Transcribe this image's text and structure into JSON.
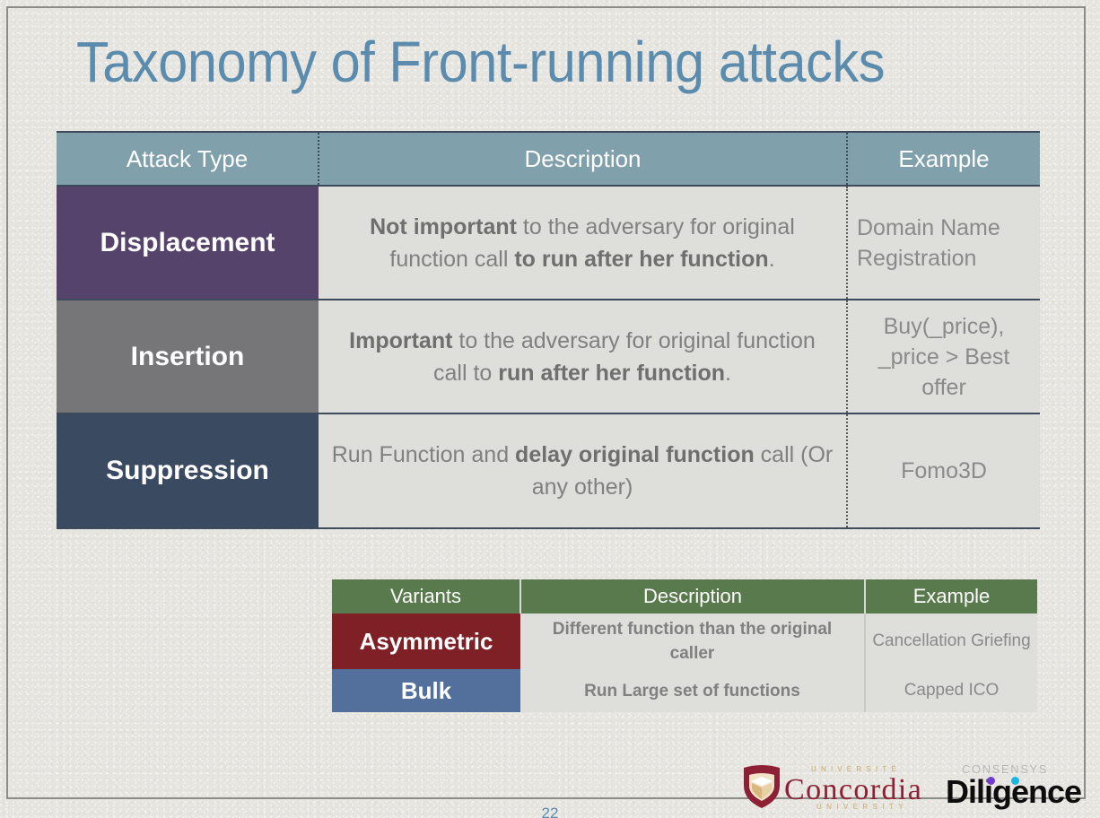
{
  "slide": {
    "title": "Taxonomy of Front-running attacks",
    "page_number": "22",
    "background_color": "#e6e5e0",
    "title_color": "#5b8cad",
    "frame_color": "#8d8d88"
  },
  "main_table": {
    "headers": [
      "Attack Type",
      "Description",
      "Example"
    ],
    "header_bg": "#80a0ac",
    "rows": [
      {
        "type": "Displacement",
        "type_color": "#56436c",
        "desc_parts": [
          {
            "text": "Not important",
            "bold": true
          },
          {
            "text": " to the adversary for original function call ",
            "bold": false
          },
          {
            "text": "to run after her function",
            "bold": true
          },
          {
            "text": ".",
            "bold": false
          }
        ],
        "desc_plain": "Not important to the adversary for original function call to run after her function.",
        "example": "Domain Name Registration",
        "example_align": "left"
      },
      {
        "type": "Insertion",
        "type_color": "#767679",
        "desc_parts": [
          {
            "text": "Important",
            "bold": true
          },
          {
            "text": " to the adversary for original function call to ",
            "bold": false
          },
          {
            "text": "run after her function",
            "bold": true
          },
          {
            "text": ".",
            "bold": false
          }
        ],
        "desc_plain": "Important to the adversary for original function call to run after her function.",
        "example": "Buy(_price), _price > Best offer",
        "example_align": "center"
      },
      {
        "type": "Suppression",
        "type_color": "#3a4a61",
        "desc_parts": [
          {
            "text": "Run Function and ",
            "bold": false
          },
          {
            "text": "delay original function",
            "bold": true
          },
          {
            "text": " call (Or any other)",
            "bold": false
          }
        ],
        "desc_plain": "Run Function and delay original function call (Or any other)",
        "example": "Fomo3D",
        "example_align": "center"
      }
    ]
  },
  "variants_table": {
    "headers": [
      "Variants",
      "Description",
      "Example"
    ],
    "header_bg": "#587a4c",
    "rows": [
      {
        "variant": "Asymmetric",
        "variant_color": "#7e2025",
        "description": "Different function than the original caller",
        "example": "Cancellation Griefing"
      },
      {
        "variant": "Bulk",
        "variant_color": "#53709c",
        "description": "Run Large set of functions",
        "example": "Capped ICO"
      }
    ]
  },
  "logos": {
    "concordia": {
      "wordmark": "Concordia",
      "sub_top": "UNIVERSITÉ",
      "sub_bottom": "UNIVERSITY",
      "color": "#8e2035",
      "accent_color": "#c8a96a"
    },
    "consensys": {
      "top_word": "CONSENSYS",
      "main_word": "Diligence",
      "top_color": "#b7b7b7",
      "main_color": "#0d0d0d",
      "dot_purple": "#6f3bd0",
      "dot_cyan": "#18b6e0"
    }
  }
}
